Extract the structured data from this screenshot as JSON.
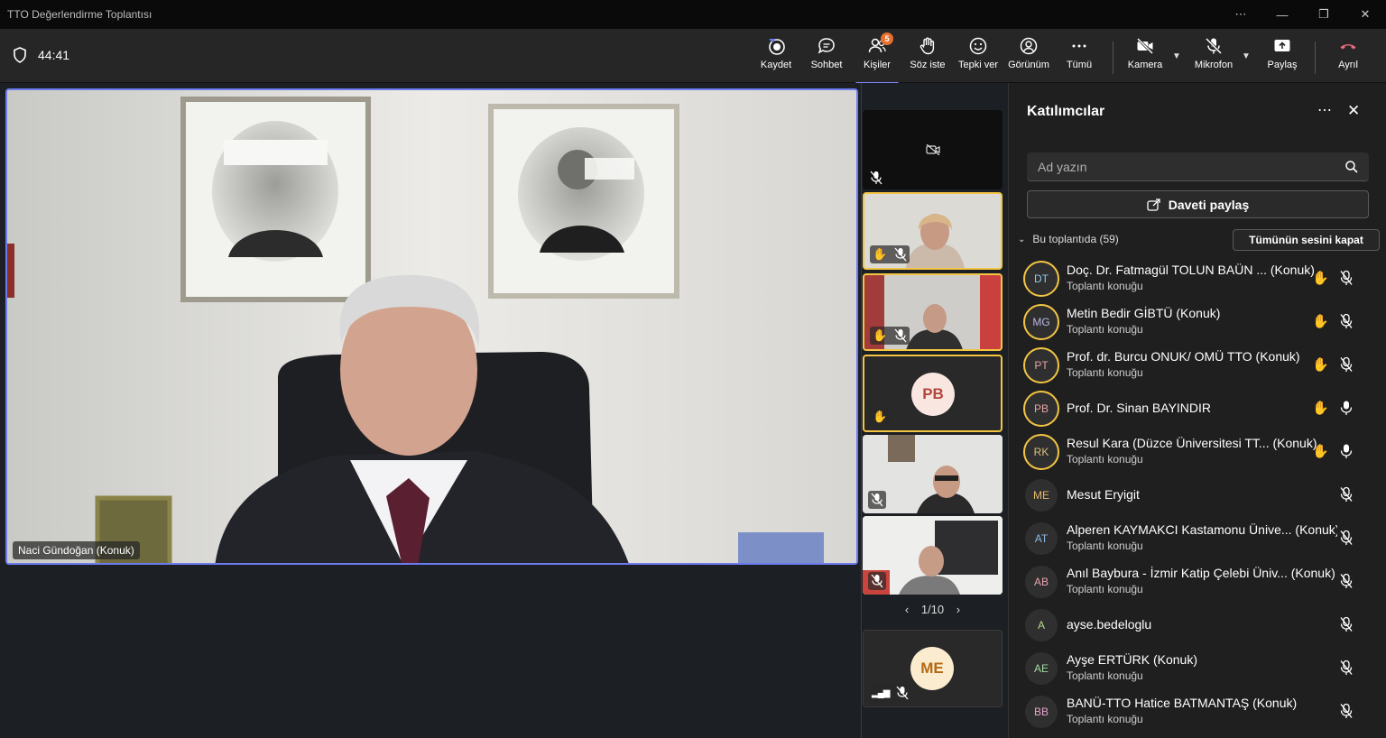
{
  "window": {
    "title": "TTO Değerlendirme Toplantısı",
    "controls": [
      "⋯",
      "—",
      "❐",
      "✕"
    ]
  },
  "toolbar": {
    "timer": "44:41",
    "buttons": [
      {
        "label": "Kaydet",
        "icon": "record-icon"
      },
      {
        "label": "Sohbet",
        "icon": "chat-icon"
      },
      {
        "label": "Kişiler",
        "icon": "people-icon",
        "badge": "5",
        "active": true
      },
      {
        "label": "Söz iste",
        "icon": "raise-hand-icon"
      },
      {
        "label": "Tepki ver",
        "icon": "react-icon"
      },
      {
        "label": "Görünüm",
        "icon": "view-icon"
      },
      {
        "label": "Tümü",
        "icon": "more-icon"
      },
      {
        "label": "Kamera",
        "icon": "camera-off-icon"
      },
      {
        "label": "Mikrofon",
        "icon": "mic-off-icon"
      },
      {
        "label": "Paylaş",
        "icon": "share-icon"
      },
      {
        "label": "Ayrıl",
        "icon": "leave-icon"
      }
    ],
    "leave_color": "#c4314b"
  },
  "main_video": {
    "name": "Naci Gündoğan (Konuk)"
  },
  "tiles": [
    {
      "avatar": ""
    },
    {
      "avatar": ""
    },
    {
      "avatar": ""
    },
    {
      "avatar": "PB"
    },
    {
      "avatar": ""
    },
    {
      "avatar": ""
    },
    {
      "avatar": "ME"
    }
  ],
  "pager": "1/10",
  "panel": {
    "title": "Katılımcılar",
    "search_placeholder": "Ad yazın",
    "invite_label": "Daveti paylaş",
    "section_label": "Bu toplantıda (59)",
    "mute_all_label": "Tümünün sesini kapat",
    "participants": [
      {
        "initials": "DT",
        "name": "Doç. Dr. Fatmagül TOLUN BAÜN ... (Konuk)",
        "sub": "Toplantı konuğu",
        "hand": true,
        "mic": "muted",
        "color": "#8ecae6"
      },
      {
        "initials": "MG",
        "name": "Metin Bedir GİBTÜ (Konuk)",
        "sub": "Toplantı konuğu",
        "hand": true,
        "mic": "muted",
        "color": "#b8b8e8"
      },
      {
        "initials": "PT",
        "name": "Prof. dr. Burcu ONUK/ OMÜ TTO (Konuk)",
        "sub": "Toplantı konuğu",
        "hand": true,
        "mic": "muted",
        "color": "#e8a3a3"
      },
      {
        "initials": "PB",
        "name": "Prof. Dr. Sinan BAYINDIR",
        "sub": "",
        "hand": true,
        "mic": "on",
        "color": "#e8a3a3"
      },
      {
        "initials": "RK",
        "name": "Resul Kara (Düzce Üniversitesi TT... (Konuk)",
        "sub": "Toplantı konuğu",
        "hand": true,
        "mic": "on",
        "color": "#d9c07a"
      },
      {
        "initials": "ME",
        "name": "Mesut Eryigit",
        "sub": "",
        "hand": false,
        "mic": "muted",
        "color": "#e8b86a"
      },
      {
        "initials": "AT",
        "name": "Alperen KAYMAKCI Kastamonu Ünive... (Konuk)",
        "sub": "Toplantı konuğu",
        "hand": false,
        "mic": "muted",
        "color": "#8fb7e0"
      },
      {
        "initials": "AB",
        "name": "Anıl Baybura - İzmir Katip Çelebi Üniv... (Konuk)",
        "sub": "Toplantı konuğu",
        "hand": false,
        "mic": "muted",
        "color": "#e8a3b0"
      },
      {
        "initials": "A",
        "name": "ayse.bedeloglu",
        "sub": "",
        "hand": false,
        "mic": "muted",
        "color": "#b8d88a"
      },
      {
        "initials": "AE",
        "name": "Ayşe ERTÜRK (Konuk)",
        "sub": "Toplantı konuğu",
        "hand": false,
        "mic": "muted",
        "color": "#a3d9a3"
      },
      {
        "initials": "BB",
        "name": "BANÜ-TTO Hatice BATMANTAŞ (Konuk)",
        "sub": "Toplantı konuğu",
        "hand": false,
        "mic": "muted",
        "color": "#e8a3c8"
      }
    ]
  }
}
